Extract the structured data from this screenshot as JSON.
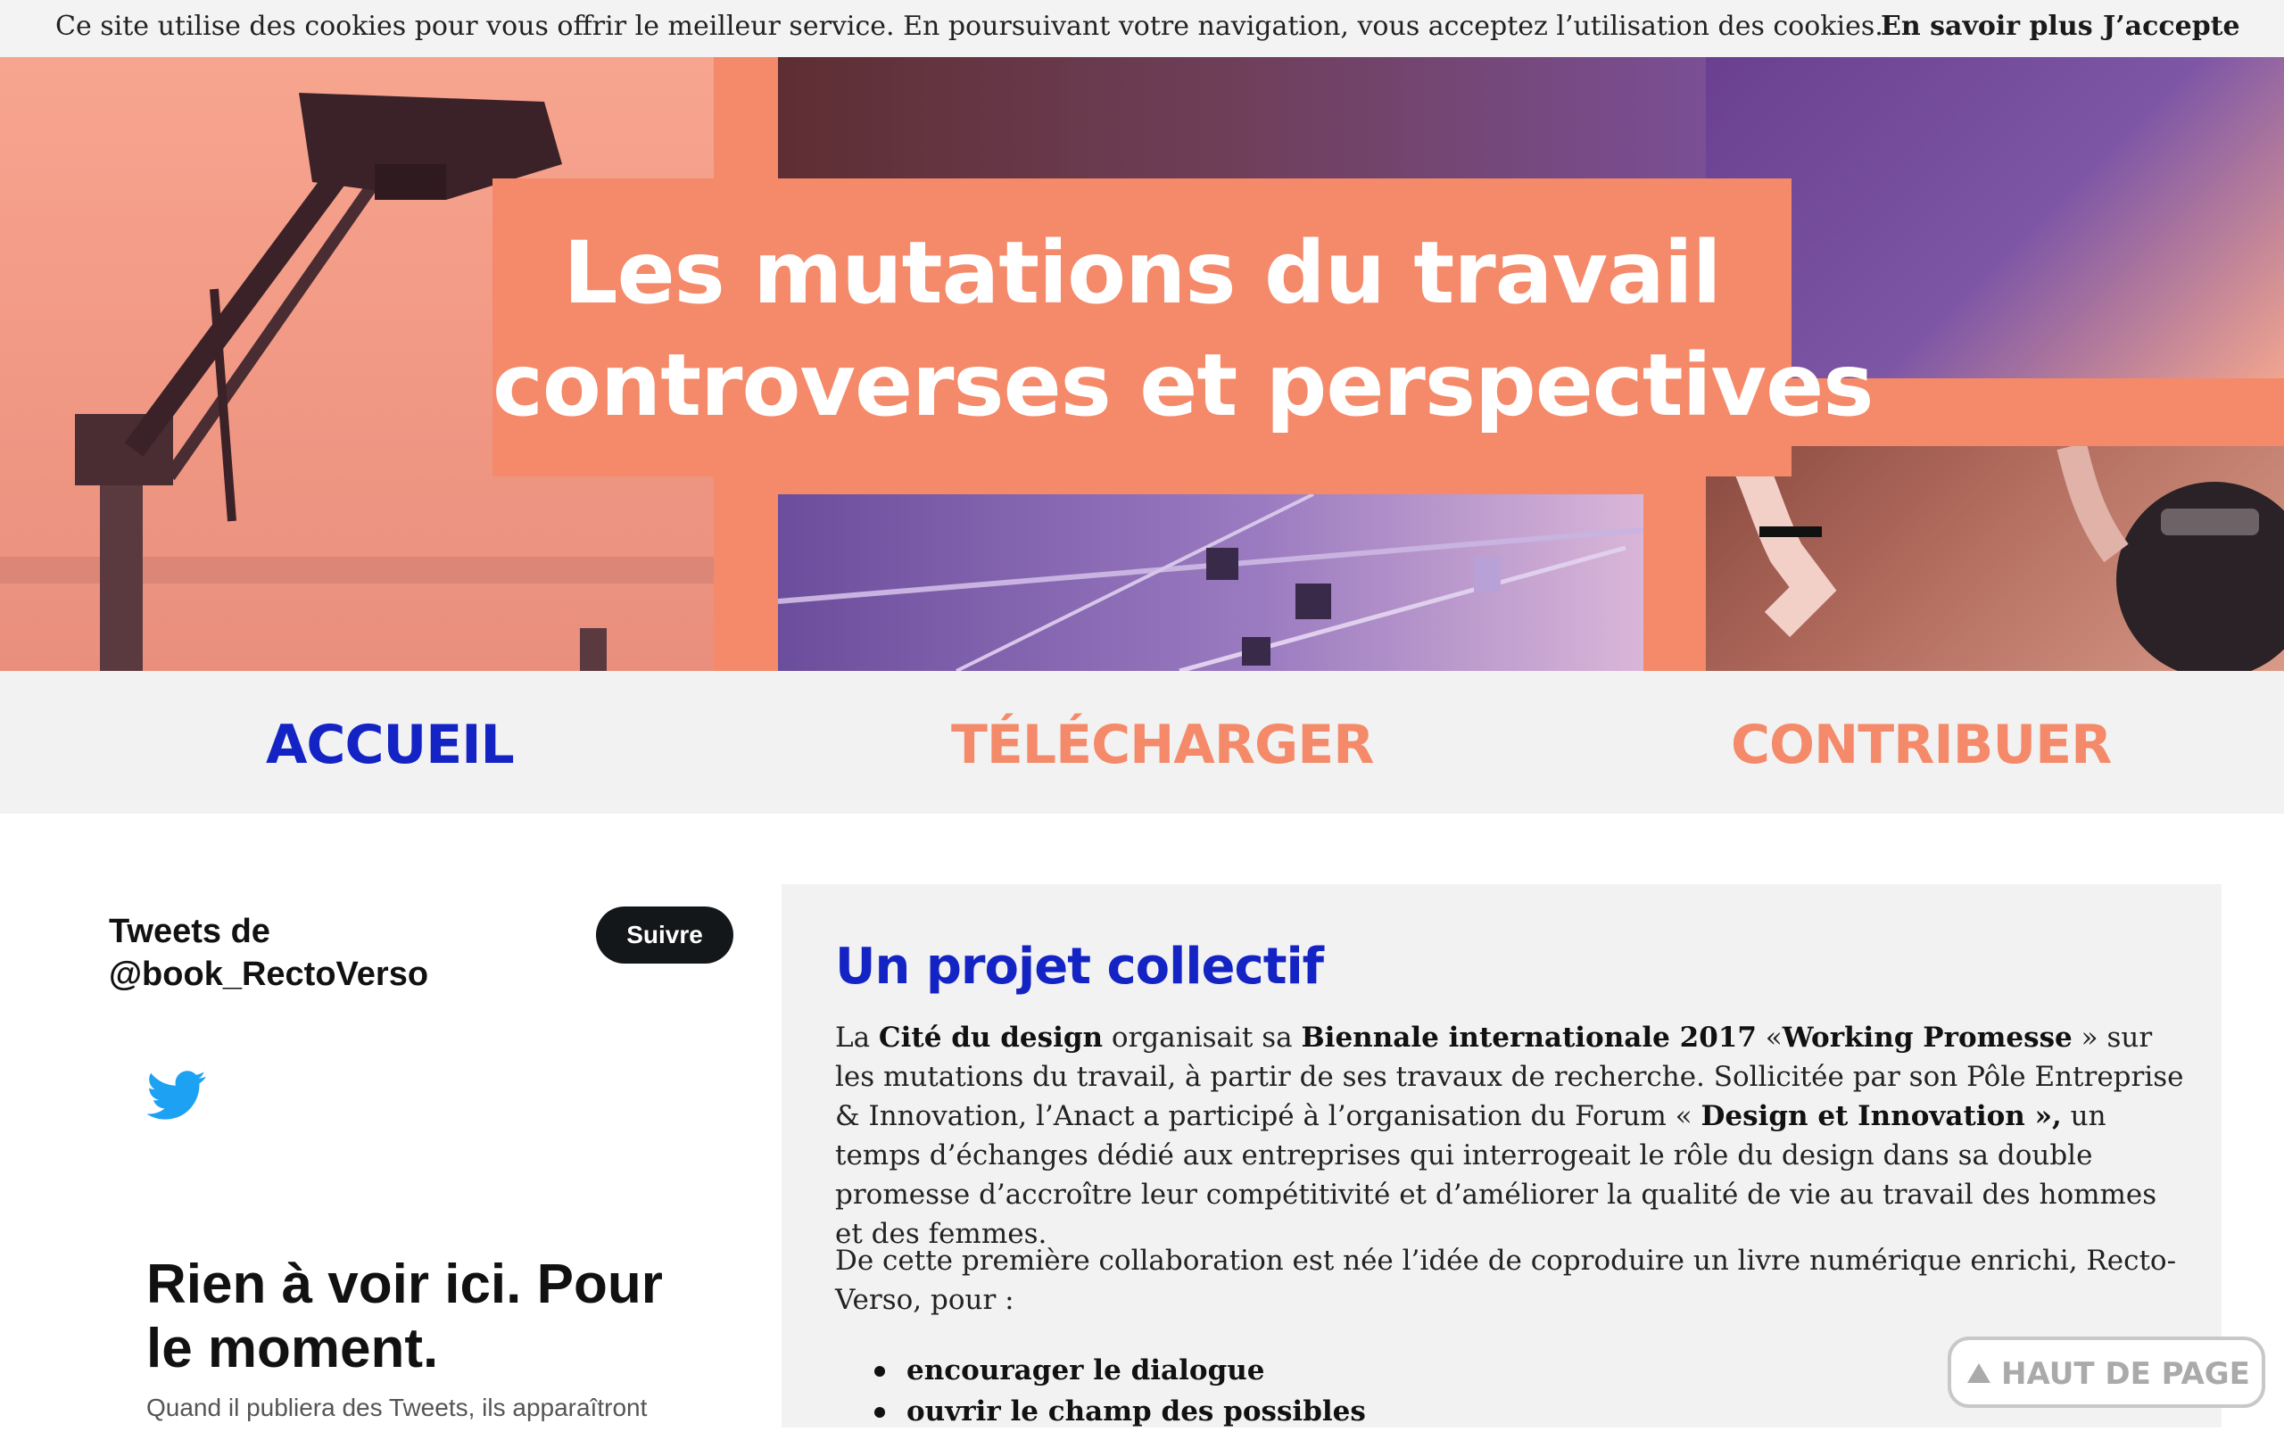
{
  "cookie_bar": {
    "text": "Ce site utilise des cookies pour vous offrir le meilleur service. En poursuivant votre navigation, vous acceptez l’utilisation des cookies.",
    "learn_more": "En savoir plus",
    "accept": "J’accepte"
  },
  "hero": {
    "title_line1": "Les mutations du travail",
    "title_line2": "controverses et perspectives",
    "accent_color": "#f48a6a"
  },
  "nav": {
    "items": [
      {
        "label": "ACCUEIL",
        "active": true
      },
      {
        "label": "TÉLÉCHARGER",
        "active": false
      },
      {
        "label": "CONTRIBUER",
        "active": false
      }
    ],
    "active_color": "#1423c4"
  },
  "twitter": {
    "title": "Tweets de @book_RectoVerso",
    "follow": "Suivre",
    "bird_icon": "twitter-bird-icon",
    "empty_title": "Rien à voir ici. Pour le moment.",
    "empty_sub": "Quand il publiera des Tweets, ils apparaîtront"
  },
  "article": {
    "title": "Un projet collectif",
    "p1": {
      "t1": "La ",
      "b1": "Cité du design",
      "t2": " organisait sa ",
      "b2": "Biennale internationale 2017",
      "t3": " «",
      "b3": "Working Promesse",
      "t4": " » sur les mutations du travail, à partir de ses travaux de recherche. Sollicitée par son Pôle Entreprise & Innovation, l’Anact a participé à l’organisation du Forum « ",
      "b4": "Design et Innovation »,",
      "t5": " un temps d’échanges dédié aux entreprises qui interrogeait le rôle du design dans sa double promesse d’accroître leur compétitivité et d’améliorer la qualité de vie au travail des hommes et des femmes."
    },
    "p2": "De cette première collaboration est née l’idée de coproduire un livre numérique enrichi, Recto-Verso, pour :",
    "list": [
      "encourager le dialogue",
      "ouvrir le champ des possibles"
    ]
  },
  "back_to_top": {
    "label": "HAUT DE PAGE",
    "icon": "triangle-up-icon"
  }
}
